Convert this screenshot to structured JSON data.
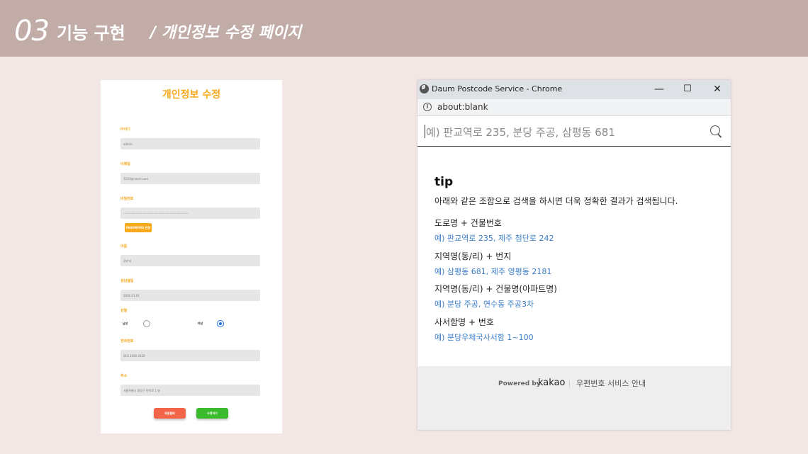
{
  "slide": {
    "number": "03",
    "title": "기능 구현",
    "subtitle": "/ 개인정보 수정 페이지"
  },
  "form": {
    "title": "개인정보 수정",
    "fields": [
      {
        "label": "아이디",
        "value": "admin"
      },
      {
        "label": "이메일",
        "value": "1234@naver.com"
      },
      {
        "label": "비밀번호",
        "value": "••••••••••••••••••••••••••••••••••••••••••••••••••••"
      },
      {
        "label": "이름",
        "value": "관리자"
      },
      {
        "label": "생년월일",
        "value": "2000.01.01"
      },
      {
        "label": "전화번호",
        "value": "010 2020 2020"
      },
      {
        "label": "주소",
        "value": "서울특별시 중랑구 면목로 1 층"
      }
    ],
    "password_button": "PASSWORD 변경",
    "gender_label": "성별",
    "gender_options": [
      {
        "label": "남성",
        "selected": false
      },
      {
        "label": "여성",
        "selected": true
      }
    ],
    "cancel_button": "회원탈퇴",
    "submit_button": "수정하기",
    "colors": {
      "accent": "#f7a81b",
      "cancel": "#f26548",
      "submit": "#3cba2e"
    }
  },
  "postcode_window": {
    "window_title": "Daum Postcode Service - Chrome",
    "controls": {
      "minimize": "—",
      "maximize": "☐",
      "close": "✕"
    },
    "url": "about:blank",
    "search_placeholder": "예) 판교역로 235, 분당 주공, 삼평동 681",
    "tip": {
      "title": "tip",
      "description": "아래와 같은 조합으로 검색을 하시면 더욱 정확한 결과가 검색됩니다.",
      "examples": [
        {
          "heading": "도로명 + 건물번호",
          "example": "예) 판교역로 235,  제주 첨단로 242"
        },
        {
          "heading": "지역명(동/리) + 번지",
          "example": "예) 삼평동 681,  제주 영평동 2181"
        },
        {
          "heading": "지역명(동/리) + 건물명(아파트명)",
          "example": "예) 분당 주공,  연수동 주공3차"
        },
        {
          "heading": "사서함명 + 번호",
          "example": "예) 분당우체국사서함 1~100"
        }
      ]
    },
    "footer": {
      "powered_by": "Powered by",
      "brand": "kakao",
      "guide_link": "우편번호 서비스 안내"
    },
    "colors": {
      "link": "#3b7ec8"
    }
  }
}
